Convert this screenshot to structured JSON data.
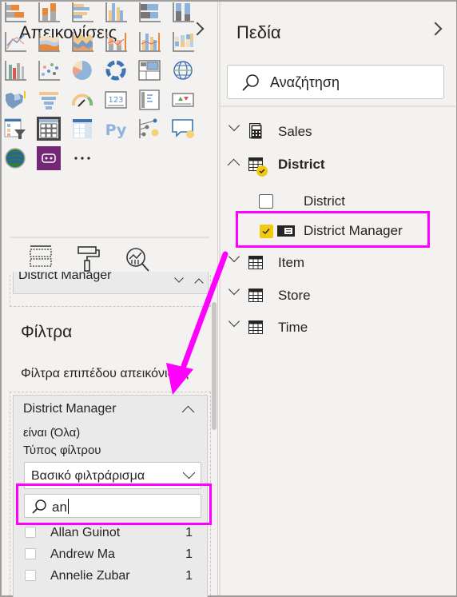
{
  "visualizations": {
    "title": "Απεικονίσεις",
    "expand_icon": "chevron-right-icon",
    "icons": [
      "stacked-bar-chart",
      "stacked-column-chart",
      "clustered-bar-chart",
      "clustered-column-chart",
      "100-stacked-bar-chart",
      "100-stacked-column-chart",
      "line-chart",
      "area-chart",
      "stacked-area-chart",
      "line-and-stacked-column-chart",
      "line-and-clustered-column-chart",
      "ribbon-chart",
      "waterfall-chart",
      "scatter-chart",
      "pie-chart",
      "donut-chart",
      "treemap",
      "map",
      "filled-map",
      "funnel",
      "gauge",
      "card",
      "multi-row-card",
      "kpi",
      "slicer",
      "table",
      "matrix",
      "python-visual",
      "key-influencers",
      "q-and-a",
      "arcgis-map",
      "power-apps",
      "more-visuals"
    ],
    "more_label": "...",
    "tabs": [
      "fields-tab",
      "format-tab",
      "analytics-tab"
    ],
    "well_field": "District Manager"
  },
  "filters": {
    "title": "Φίλτρα",
    "level_label": "Φίλτρα επιπέδου απεικόνισης",
    "card": {
      "field": "District Manager",
      "condition": "είναι (Όλα)",
      "filter_type_label": "Τύπος φίλτρου",
      "filter_type_value": "Βασικό φιλτράρισμα",
      "search_value": "an",
      "items": [
        {
          "label": "Allan Guinot",
          "count": "1",
          "checked": false
        },
        {
          "label": "Andrew Ma",
          "count": "1",
          "checked": false
        },
        {
          "label": "Annelie Zubar",
          "count": "1",
          "checked": false
        }
      ]
    }
  },
  "fields": {
    "title": "Πεδία",
    "expand_icon": "chevron-right-icon",
    "search_placeholder": "Αναζήτηση",
    "tables": [
      {
        "name": "Sales",
        "expanded": false,
        "icon": "calculator-icon"
      },
      {
        "name": "District",
        "expanded": true,
        "icon": "table-icon",
        "has_selection": true,
        "fields": [
          {
            "name": "District",
            "checked": false
          },
          {
            "name": "District Manager",
            "checked": true,
            "icon": "hierarchy-field-icon"
          }
        ]
      },
      {
        "name": "Item",
        "expanded": false,
        "icon": "table-icon"
      },
      {
        "name": "Store",
        "expanded": false,
        "icon": "table-icon"
      },
      {
        "name": "Time",
        "expanded": false,
        "icon": "table-icon"
      }
    ]
  },
  "annotations": {
    "highlight_color": "#ff00ff",
    "arrow_color": "#ff00ff",
    "accent_yellow": "#f2c811"
  }
}
